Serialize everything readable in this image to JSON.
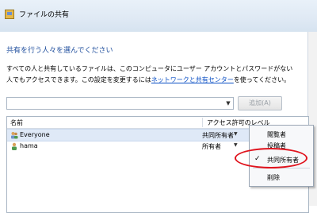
{
  "window": {
    "title": "ファイルの共有"
  },
  "heading": "共有を行う人々を選んでください",
  "description": {
    "line1": "すべての人と共有しているファイルは、このコンピュータにユーザー アカウントとパスワードがない",
    "line2_before": "人でもアクセスできます。この設定を変更するには",
    "line2_link": "ネットワークと共有センター",
    "line2_after": "を使ってください。"
  },
  "combo": {
    "value": ""
  },
  "add_button": {
    "label": "追加(A)"
  },
  "list": {
    "columns": {
      "name": "名前",
      "permission": "アクセス許可のレベル"
    },
    "rows": [
      {
        "name": "Everyone",
        "permission": "共同所有者",
        "icon": "group-user-icon"
      },
      {
        "name": "hama",
        "permission": "所有者",
        "icon": "user-icon"
      }
    ]
  },
  "menu": {
    "items": [
      {
        "label": "閲覧者",
        "checked": false
      },
      {
        "label": "投稿者",
        "checked": false
      },
      {
        "label": "共同所有者",
        "checked": true
      },
      {
        "label": "削除",
        "checked": false
      }
    ],
    "check_glyph": "✓"
  },
  "colors": {
    "highlight_ring": "#e0141e",
    "link": "#0b4fc4",
    "heading": "#1f4e9d"
  }
}
